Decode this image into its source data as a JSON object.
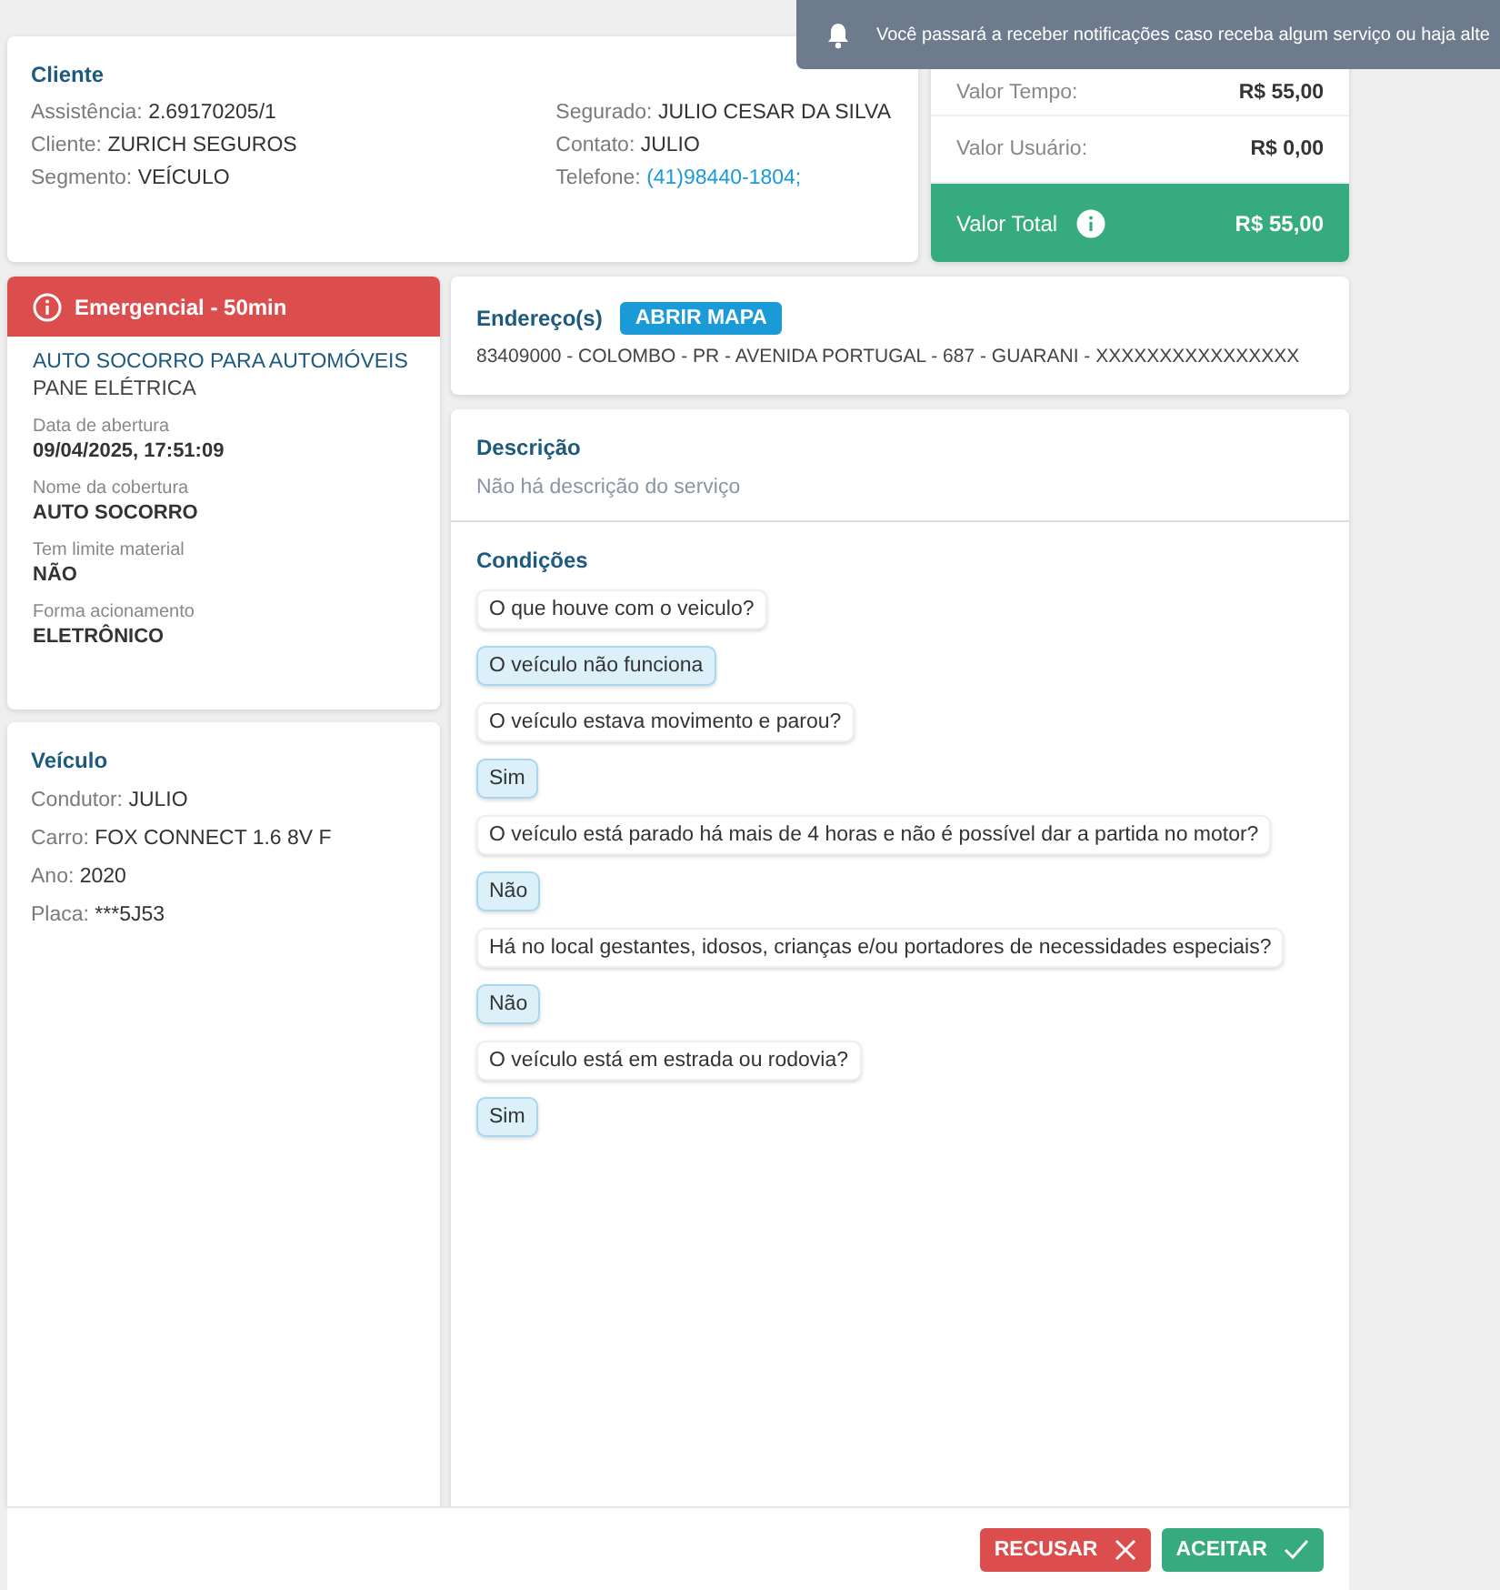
{
  "toast": {
    "text": "Você passará a receber notificações caso receba algum serviço ou haja alte"
  },
  "client": {
    "title": "Cliente",
    "left": [
      {
        "label": "Assistência:",
        "value": "2.69170205/1"
      },
      {
        "label": "Cliente:",
        "value": "ZURICH SEGUROS"
      },
      {
        "label": "Segmento:",
        "value": "VEÍCULO"
      }
    ],
    "right": [
      {
        "label": "Segurado:",
        "value": "JULIO CESAR DA SILVA",
        "link": false
      },
      {
        "label": "Contato:",
        "value": "JULIO",
        "link": false
      },
      {
        "label": "Telefone:",
        "value": "(41)98440-1804;",
        "link": true
      }
    ]
  },
  "values": {
    "rows": [
      {
        "label": "Valor Tempo:",
        "value": "R$ 55,00"
      },
      {
        "label": "Valor Usuário:",
        "value": "R$ 0,00"
      }
    ],
    "total": {
      "label": "Valor Total",
      "value": "R$ 55,00"
    }
  },
  "service": {
    "badge": "Emergencial - 50min",
    "title": "AUTO SOCORRO PARA AUTOMÓVEIS",
    "subtitle": "PANE ELÉTRICA",
    "fields": [
      {
        "label": "Data de abertura",
        "value": "09/04/2025, 17:51:09"
      },
      {
        "label": "Nome da cobertura",
        "value": "AUTO SOCORRO"
      },
      {
        "label": "Tem limite material",
        "value": "NÃO"
      },
      {
        "label": "Forma acionamento",
        "value": "ELETRÔNICO"
      }
    ]
  },
  "vehicle": {
    "title": "Veículo",
    "rows": [
      {
        "label": "Condutor:",
        "value": "JULIO"
      },
      {
        "label": "Carro:",
        "value": "FOX CONNECT 1.6 8V F"
      },
      {
        "label": "Ano:",
        "value": "2020"
      },
      {
        "label": "Placa:",
        "value": "***5J53"
      }
    ]
  },
  "address": {
    "title": "Endereço(s)",
    "button": "ABRIR MAPA",
    "text": "83409000 - COLOMBO - PR - AVENIDA PORTUGAL - 687 - GUARANI - XXXXXXXXXXXXXXXX"
  },
  "description": {
    "title": "Descrição",
    "text": "Não há descrição do serviço"
  },
  "conditions": {
    "title": "Condições",
    "items": [
      {
        "kind": "question",
        "text": "O que houve com o veiculo?"
      },
      {
        "kind": "answer",
        "text": "O veículo não funciona"
      },
      {
        "kind": "question",
        "text": "O veículo estava movimento e parou?"
      },
      {
        "kind": "answer",
        "text": "Sim"
      },
      {
        "kind": "question",
        "text": "O veículo está parado há mais de 4 horas e não é possível dar a partida no motor?"
      },
      {
        "kind": "answer",
        "text": "Não"
      },
      {
        "kind": "question",
        "text": "Há no local gestantes, idosos, crianças e/ou portadores de necessidades especiais?"
      },
      {
        "kind": "answer",
        "text": "Não"
      },
      {
        "kind": "question",
        "text": "O veículo está em estrada ou rodovia?"
      },
      {
        "kind": "answer",
        "text": "Sim"
      }
    ]
  },
  "actions": {
    "reject": "RECUSAR",
    "accept": "ACEITAR"
  }
}
